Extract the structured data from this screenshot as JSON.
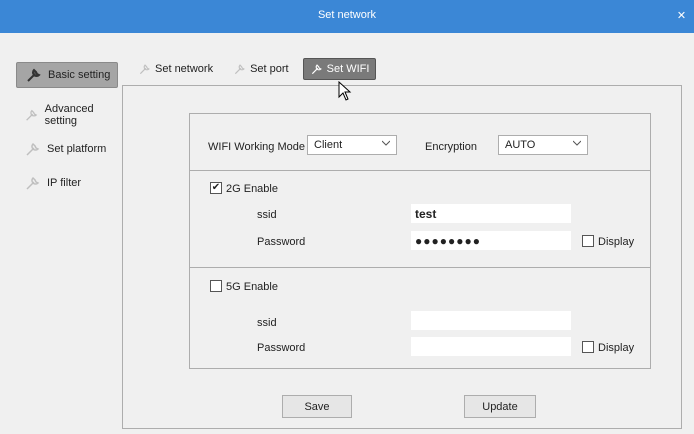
{
  "window": {
    "title": "Set network",
    "close_glyph": "✕"
  },
  "sidebar": {
    "items": [
      {
        "label": "Basic setting",
        "icon": "wrench-icon"
      },
      {
        "label": "Advanced setting",
        "icon": "wrench-icon"
      },
      {
        "label": "Set platform",
        "icon": "wrench-icon"
      },
      {
        "label": "IP filter",
        "icon": "wrench-icon"
      }
    ]
  },
  "tabs": [
    {
      "label": "Set network",
      "icon": "wrench-icon"
    },
    {
      "label": "Set port",
      "icon": "wrench-icon"
    },
    {
      "label": "Set WIFI",
      "icon": "wrench-icon"
    }
  ],
  "wifi": {
    "working_mode_label": "WIFI Working Mode",
    "working_mode_value": "Client",
    "encryption_label": "Encryption",
    "encryption_value": "AUTO",
    "band_2g": {
      "enable_label": "2G Enable",
      "enabled": true,
      "ssid_label": "ssid",
      "ssid_value": "test",
      "password_label": "Password",
      "password_value": "●●●●●●●●",
      "display_label": "Display"
    },
    "band_5g": {
      "enable_label": "5G Enable",
      "enabled": false,
      "ssid_label": "ssid",
      "ssid_value": "",
      "password_label": "Password",
      "password_value": "",
      "display_label": "Display"
    }
  },
  "actions": {
    "save_label": "Save",
    "update_label": "Update"
  },
  "check_glyph": "✔"
}
